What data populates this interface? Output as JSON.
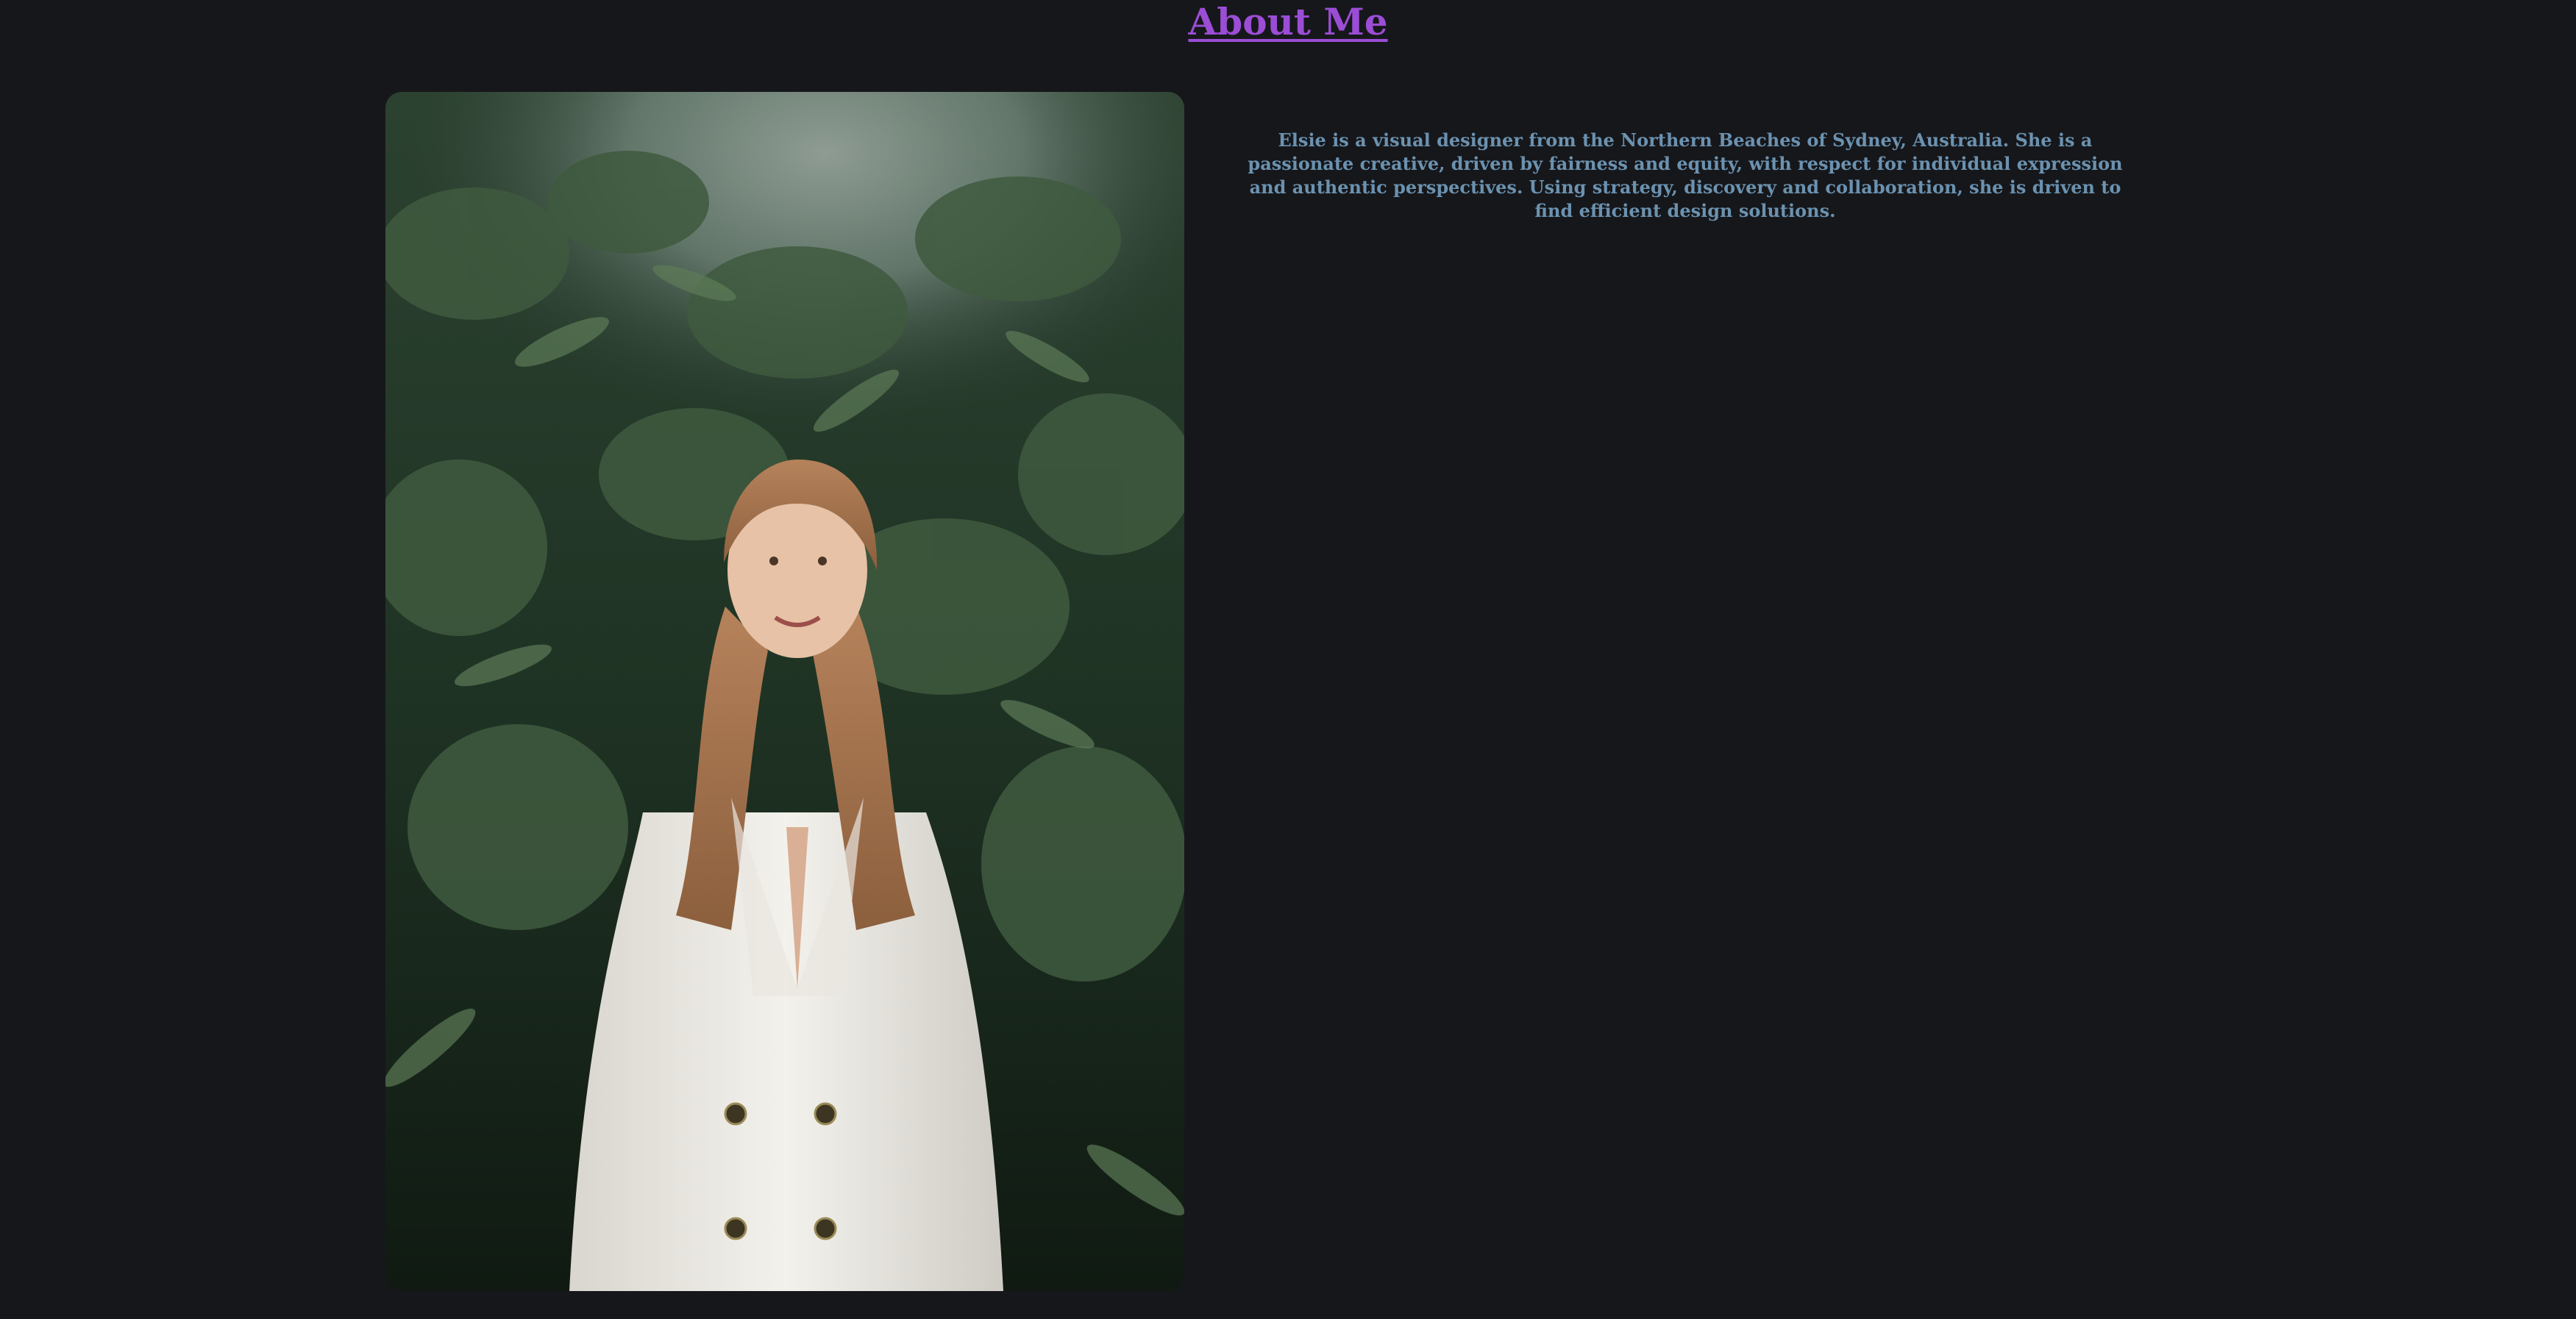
{
  "page": {
    "title": "About Me",
    "title_color": "#9b4dd6",
    "background_color": "#16171b"
  },
  "about": {
    "bio": "Elsie is a visual designer from the Northern Beaches of Sydney, Australia. She is a passionate creative, driven by fairness and equity, with respect for individual expression and authentic perspectives. Using strategy, discovery and collaboration, she is driven to find efficient design solutions.",
    "bio_color": "#6b92b0",
    "photo_icon": "portrait-photo"
  }
}
